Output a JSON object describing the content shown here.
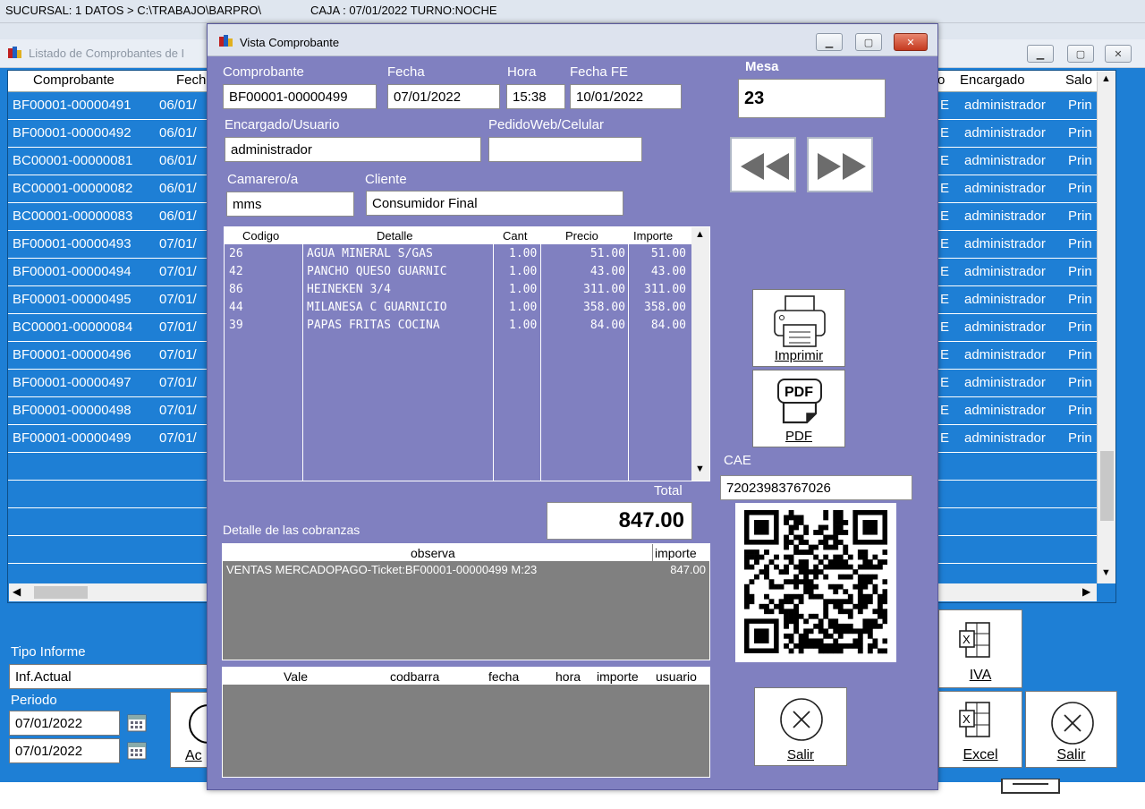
{
  "appbar": {
    "sucursal": "SUCURSAL: 1 DATOS > C:\\TRABAJO\\BARPRO\\",
    "caja": "CAJA : 07/01/2022 TURNO:NOCHE"
  },
  "bg_window": {
    "title": "Listado de Comprobantes de I",
    "columns": {
      "comprobante": "Comprobante",
      "fecha": "Fech",
      "col_o": "o",
      "encargado": "Encargado",
      "salon": "Salo"
    },
    "rows": [
      {
        "comprobante": "BF00001-00000491",
        "fecha": "06/01/",
        "e": "E",
        "encargado": "administrador",
        "salon": "Prin"
      },
      {
        "comprobante": "BF00001-00000492",
        "fecha": "06/01/",
        "e": "E",
        "encargado": "administrador",
        "salon": "Prin"
      },
      {
        "comprobante": "BC00001-00000081",
        "fecha": "06/01/",
        "e": "E",
        "encargado": "administrador",
        "salon": "Prin"
      },
      {
        "comprobante": "BC00001-00000082",
        "fecha": "06/01/",
        "e": "E",
        "encargado": "administrador",
        "salon": "Prin"
      },
      {
        "comprobante": "BC00001-00000083",
        "fecha": "06/01/",
        "e": "E",
        "encargado": "administrador",
        "salon": "Prin"
      },
      {
        "comprobante": "BF00001-00000493",
        "fecha": "07/01/",
        "e": "E",
        "encargado": "administrador",
        "salon": "Prin"
      },
      {
        "comprobante": "BF00001-00000494",
        "fecha": "07/01/",
        "e": "E",
        "encargado": "administrador",
        "salon": "Prin"
      },
      {
        "comprobante": "BF00001-00000495",
        "fecha": "07/01/",
        "e": "E",
        "encargado": "administrador",
        "salon": "Prin"
      },
      {
        "comprobante": "BC00001-00000084",
        "fecha": "07/01/",
        "e": "E",
        "encargado": "administrador",
        "salon": "Prin"
      },
      {
        "comprobante": "BF00001-00000496",
        "fecha": "07/01/",
        "e": "E",
        "encargado": "administrador",
        "salon": "Prin"
      },
      {
        "comprobante": "BF00001-00000497",
        "fecha": "07/01/",
        "e": "E",
        "encargado": "administrador",
        "salon": "Prin"
      },
      {
        "comprobante": "BF00001-00000498",
        "fecha": "07/01/",
        "e": "E",
        "encargado": "administrador",
        "salon": "Prin"
      },
      {
        "comprobante": "BF00001-00000499",
        "fecha": "07/01/",
        "e": "E",
        "encargado": "administrador",
        "salon": "Prin"
      }
    ],
    "tipo_informe_label": "Tipo Informe",
    "tipo_informe_value": "Inf.Actual",
    "periodo_label": "Periodo",
    "periodo_desde": "07/01/2022",
    "periodo_hasta": "07/01/2022",
    "btn_ac": "Ac",
    "btn_iva": "IVA",
    "btn_excel": "Excel",
    "btn_salir": "Salir"
  },
  "modal": {
    "title": "Vista Comprobante",
    "comprobante_label": "Comprobante",
    "comprobante_value": "BF00001-00000499",
    "fecha_label": "Fecha",
    "fecha_value": "07/01/2022",
    "hora_label": "Hora",
    "hora_value": "15:38",
    "fechafe_label": "Fecha FE",
    "fechafe_value": "10/01/2022",
    "mesa_label": "Mesa",
    "mesa_value": "23",
    "encargado_label": "Encargado/Usuario",
    "encargado_value": "administrador",
    "pedido_label": "PedidoWeb/Celular",
    "pedido_value": "",
    "camarero_label": "Camarero/a",
    "camarero_value": "mms",
    "cliente_label": "Cliente",
    "cliente_value": "Consumidor Final",
    "items_columns": {
      "codigo": "Codigo",
      "detalle": "Detalle",
      "cant": "Cant",
      "precio": "Precio",
      "importe": "Importe"
    },
    "items": [
      {
        "codigo": "26",
        "detalle": "AGUA MINERAL S/GAS",
        "cant": "1.00",
        "precio": "51.00",
        "importe": "51.00"
      },
      {
        "codigo": "42",
        "detalle": "PANCHO QUESO GUARNIC",
        "cant": "1.00",
        "precio": "43.00",
        "importe": "43.00"
      },
      {
        "codigo": "86",
        "detalle": "HEINEKEN 3/4",
        "cant": "1.00",
        "precio": "311.00",
        "importe": "311.00"
      },
      {
        "codigo": "44",
        "detalle": "MILANESA C GUARNICIO",
        "cant": "1.00",
        "precio": "358.00",
        "importe": "358.00"
      },
      {
        "codigo": "39",
        "detalle": "PAPAS FRITAS COCINA",
        "cant": "1.00",
        "precio": "84.00",
        "importe": "84.00"
      }
    ],
    "total_label": "Total",
    "total_value": "847.00",
    "cobranzas_label": "Detalle de las cobranzas",
    "cobranzas_columns": {
      "observa": "observa",
      "importe": "importe"
    },
    "cobranzas": [
      {
        "observa": "VENTAS MERCADOPAGO-Ticket:BF00001-00000499 M:23",
        "importe": "847.00"
      }
    ],
    "vales_columns": {
      "vale": "Vale",
      "codbarra": "codbarra",
      "fecha": "fecha",
      "hora": "hora",
      "importe": "importe",
      "usuario": "usuario"
    },
    "imprimir_label": "Imprimir",
    "pdf_label": "PDF",
    "pdf_icon_text": "PDF",
    "cae_label": "CAE",
    "cae_value": "72023983767026",
    "salir_label": "Salir"
  },
  "icons": {
    "app": "app-icon",
    "printer": "printer-icon",
    "pdf": "pdf-icon",
    "excel": "excel-icon",
    "close": "close-circle-icon",
    "calendar": "calendar-icon",
    "qr": "qr-code-icon"
  },
  "colors": {
    "modal_bg": "#8080c0",
    "grid_bg": "#1e7fd5",
    "collections_bg": "#808080"
  }
}
